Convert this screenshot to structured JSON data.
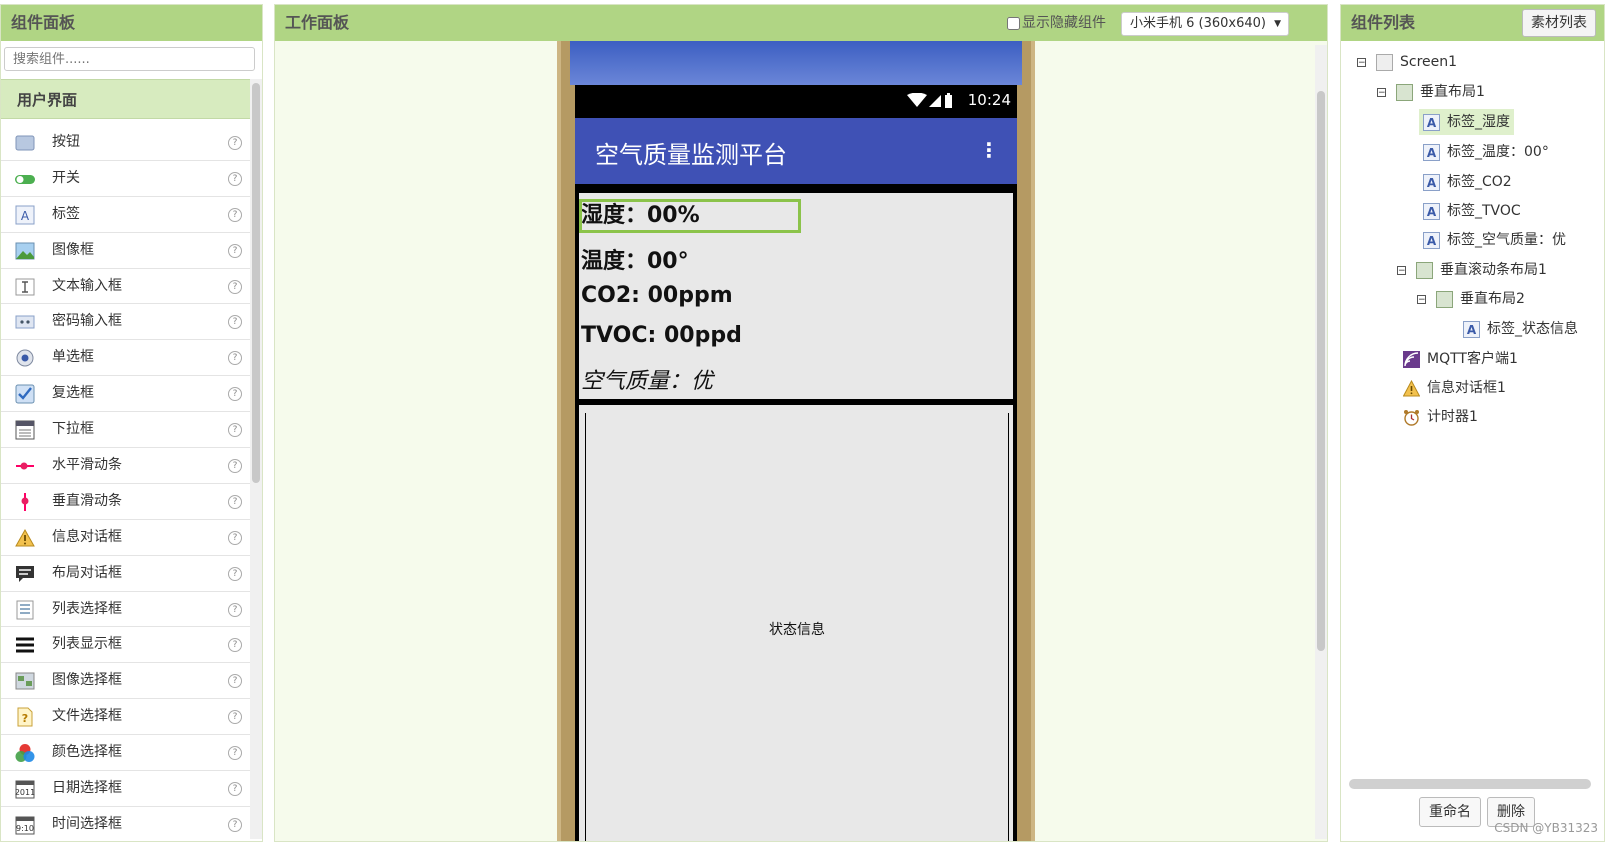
{
  "palette": {
    "title": "组件面板",
    "search_placeholder": "搜索组件......",
    "category": "用户界面",
    "help": "?",
    "items": [
      {
        "label": "按钮"
      },
      {
        "label": "开关"
      },
      {
        "label": "标签"
      },
      {
        "label": "图像框"
      },
      {
        "label": "文本输入框"
      },
      {
        "label": "密码输入框"
      },
      {
        "label": "单选框"
      },
      {
        "label": "复选框"
      },
      {
        "label": "下拉框"
      },
      {
        "label": "水平滑动条"
      },
      {
        "label": "垂直滑动条"
      },
      {
        "label": "信息对话框"
      },
      {
        "label": "布局对话框"
      },
      {
        "label": "列表选择框"
      },
      {
        "label": "列表显示框"
      },
      {
        "label": "图像选择框"
      },
      {
        "label": "文件选择框"
      },
      {
        "label": "颜色选择框"
      },
      {
        "label": "日期选择框"
      },
      {
        "label": "时间选择框"
      }
    ]
  },
  "workspace": {
    "title": "工作面板",
    "show_hidden": "显示隐藏组件",
    "device": "小米手机 6 (360x640)",
    "phone": {
      "time": "10:24",
      "app_title": "空气质量监测平台",
      "labels": {
        "humidity": "湿度：00%",
        "temperature": "温度：00°",
        "co2": "CO2: 00ppm",
        "tvoc": "TVOC: 00ppd",
        "air_quality": "空气质量：优"
      },
      "status_info": "状态信息"
    }
  },
  "tree": {
    "title": "组件列表",
    "assets_button": "素材列表",
    "items": {
      "screen": "Screen1",
      "vlayout1": "垂直布局1",
      "label_humidity": "标签_湿度",
      "label_temp": "标签_温度：00°",
      "label_co2": "标签_CO2",
      "label_tvoc": "标签_TVOC",
      "label_air": "标签_空气质量：优",
      "vscroll1": "垂直滚动条布局1",
      "vlayout2": "垂直布局2",
      "label_status": "标签_状态信息",
      "mqtt": "MQTT客户端1",
      "notifier": "信息对话框1",
      "clock": "计时器1"
    },
    "rename_button": "重命名",
    "delete_button": "删除"
  },
  "watermark": "CSDN @YB31323"
}
